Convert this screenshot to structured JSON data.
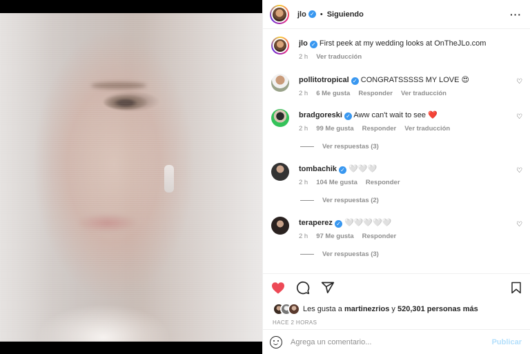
{
  "header": {
    "username": "jlo",
    "follow_status": "Siguiendo",
    "separator": "•"
  },
  "caption": {
    "username": "jlo",
    "text": "First peek at my wedding looks at OnTheJLo.com",
    "time": "2 h",
    "translate": "Ver traducción"
  },
  "comments": [
    {
      "username": "pollitotropical",
      "text": "CONGRATSSSSS MY LOVE 😍",
      "time": "2 h",
      "likes": "6 Me gusta",
      "reply": "Responder",
      "translate": "Ver traducción"
    },
    {
      "username": "bradgoreski",
      "text": "Aww can't wait to see ❤️",
      "time": "2 h",
      "likes": "99 Me gusta",
      "reply": "Responder",
      "translate": "Ver traducción",
      "replies": "Ver respuestas (3)"
    },
    {
      "username": "tombachik",
      "text": "🤍🤍🤍",
      "time": "2 h",
      "likes": "104 Me gusta",
      "reply": "Responder",
      "replies": "Ver respuestas (2)"
    },
    {
      "username": "teraperez",
      "text": "🤍🤍🤍🤍🤍",
      "time": "2 h",
      "likes": "97 Me gusta",
      "reply": "Responder",
      "replies": "Ver respuestas (3)"
    }
  ],
  "likes": {
    "prefix": "Les gusta a",
    "user": "martinezrios",
    "connector": "y",
    "count": "520,301 personas más"
  },
  "time_ago": "HACE 2 HORAS",
  "composer": {
    "placeholder": "Agrega un comentario...",
    "publish": "Publicar"
  },
  "colors": {
    "like_red": "#ed4956",
    "verified_blue": "#3897f0",
    "publish_disabled": "#b2dffc"
  },
  "icons": [
    "heart-icon",
    "comment-icon",
    "share-icon",
    "bookmark-icon",
    "emoji-icon",
    "more-icon",
    "verified-icon"
  ]
}
